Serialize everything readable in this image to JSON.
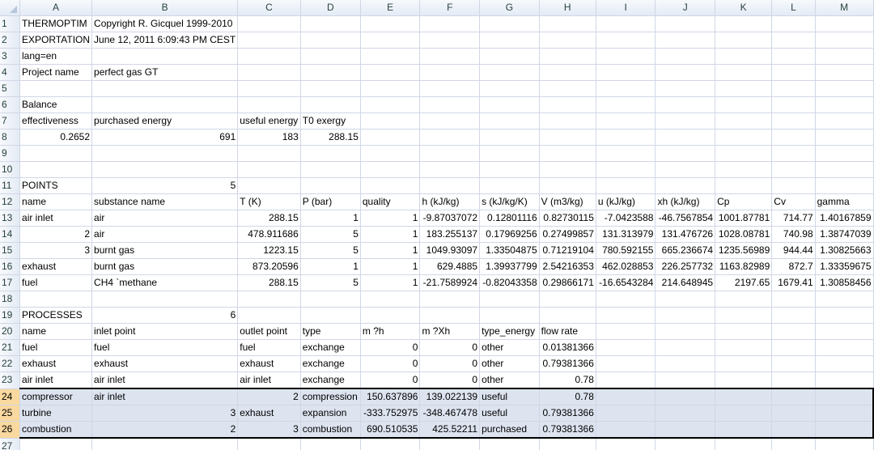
{
  "columns": [
    "A",
    "B",
    "C",
    "D",
    "E",
    "F",
    "G",
    "H",
    "I",
    "J",
    "K",
    "L",
    "M"
  ],
  "rows": [
    {
      "n": "1",
      "cells": [
        "THERMOPTIM",
        "Copyright R. Gicquel 1999-2010",
        "",
        "",
        "",
        "",
        "",
        "",
        "",
        "",
        "",
        "",
        ""
      ]
    },
    {
      "n": "2",
      "cells": [
        "EXPORTATION",
        "June 12, 2011 6:09:43 PM CEST",
        "",
        "",
        "",
        "",
        "",
        "",
        "",
        "",
        "",
        "",
        ""
      ]
    },
    {
      "n": "3",
      "cells": [
        "lang=en",
        "",
        "",
        "",
        "",
        "",
        "",
        "",
        "",
        "",
        "",
        "",
        ""
      ]
    },
    {
      "n": "4",
      "cells": [
        "Project name",
        "perfect gas GT",
        "",
        "",
        "",
        "",
        "",
        "",
        "",
        "",
        "",
        "",
        ""
      ]
    },
    {
      "n": "5",
      "cells": [
        "",
        "",
        "",
        "",
        "",
        "",
        "",
        "",
        "",
        "",
        "",
        "",
        ""
      ]
    },
    {
      "n": "6",
      "cells": [
        "Balance",
        "",
        "",
        "",
        "",
        "",
        "",
        "",
        "",
        "",
        "",
        "",
        ""
      ]
    },
    {
      "n": "7",
      "cells": [
        "effectiveness",
        "purchased energy",
        "useful energy",
        "T0 exergy",
        "",
        "",
        "",
        "",
        "",
        "",
        "",
        "",
        ""
      ]
    },
    {
      "n": "8",
      "cells": [
        "0.2652",
        "691",
        "183",
        "288.15",
        "",
        "",
        "",
        "",
        "",
        "",
        "",
        "",
        ""
      ]
    },
    {
      "n": "9",
      "cells": [
        "",
        "",
        "",
        "",
        "",
        "",
        "",
        "",
        "",
        "",
        "",
        "",
        ""
      ]
    },
    {
      "n": "10",
      "cells": [
        "",
        "",
        "",
        "",
        "",
        "",
        "",
        "",
        "",
        "",
        "",
        "",
        ""
      ]
    },
    {
      "n": "11",
      "cells": [
        "POINTS",
        "5",
        "",
        "",
        "",
        "",
        "",
        "",
        "",
        "",
        "",
        "",
        ""
      ]
    },
    {
      "n": "12",
      "cells": [
        "name",
        "substance name",
        "T (K)",
        "P (bar)",
        "quality",
        "h (kJ/kg)",
        "s (kJ/kg/K)",
        "V (m3/kg)",
        "u (kJ/kg)",
        "xh (kJ/kg)",
        "Cp",
        "Cv",
        "gamma"
      ]
    },
    {
      "n": "13",
      "cells": [
        "air inlet",
        "air",
        "288.15",
        "1",
        "1",
        "-9.87037072",
        "0.12801116",
        "0.82730115",
        "-7.0423588",
        "-46.7567854",
        "1001.87781",
        "714.77",
        "1.40167859"
      ]
    },
    {
      "n": "14",
      "cells": [
        "2",
        "air",
        "478.911686",
        "5",
        "1",
        "183.255137",
        "0.17969256",
        "0.27499857",
        "131.313979",
        "131.476726",
        "1028.08781",
        "740.98",
        "1.38747039"
      ]
    },
    {
      "n": "15",
      "cells": [
        "3",
        "burnt gas",
        "1223.15",
        "5",
        "1",
        "1049.93097",
        "1.33504875",
        "0.71219104",
        "780.592155",
        "665.236674",
        "1235.56989",
        "944.44",
        "1.30825663"
      ]
    },
    {
      "n": "16",
      "cells": [
        "exhaust",
        "burnt gas",
        "873.20596",
        "1",
        "1",
        "629.4885",
        "1.39937799",
        "2.54216353",
        "462.028853",
        "226.257732",
        "1163.82989",
        "872.7",
        "1.33359675"
      ]
    },
    {
      "n": "17",
      "cells": [
        "fuel",
        "CH4 `methane",
        "288.15",
        "5",
        "1",
        "-21.7589924",
        "-0.82043358",
        "0.29866171",
        "-16.6543284",
        "214.648945",
        "2197.65",
        "1679.41",
        "1.30858456"
      ]
    },
    {
      "n": "18",
      "cells": [
        "",
        "",
        "",
        "",
        "",
        "",
        "",
        "",
        "",
        "",
        "",
        "",
        ""
      ]
    },
    {
      "n": "19",
      "cells": [
        "PROCESSES",
        "6",
        "",
        "",
        "",
        "",
        "",
        "",
        "",
        "",
        "",
        "",
        ""
      ]
    },
    {
      "n": "20",
      "cells": [
        "name",
        "inlet point",
        "outlet point",
        "type",
        "m ?h",
        "m ?Xh",
        "type_energy",
        "flow rate",
        "",
        "",
        "",
        "",
        ""
      ]
    },
    {
      "n": "21",
      "cells": [
        "fuel",
        "fuel",
        "fuel",
        "exchange",
        "0",
        "0",
        "other",
        "0.01381366",
        "",
        "",
        "",
        "",
        ""
      ]
    },
    {
      "n": "22",
      "cells": [
        "exhaust",
        "exhaust",
        "exhaust",
        "exchange",
        "0",
        "0",
        "other",
        "0.79381366",
        "",
        "",
        "",
        "",
        ""
      ]
    },
    {
      "n": "23",
      "cells": [
        "air inlet",
        "air inlet",
        "air inlet",
        "exchange",
        "0",
        "0",
        "other",
        "0.78",
        "",
        "",
        "",
        "",
        ""
      ]
    },
    {
      "n": "24",
      "cells": [
        "compressor",
        "air inlet",
        "2",
        "compression",
        "150.637896",
        "139.022139",
        "useful",
        "0.78",
        "",
        "",
        "",
        "",
        ""
      ]
    },
    {
      "n": "25",
      "cells": [
        "turbine",
        "3",
        "exhaust",
        "expansion",
        "-333.752975",
        "-348.467478",
        "useful",
        "0.79381366",
        "",
        "",
        "",
        "",
        ""
      ]
    },
    {
      "n": "26",
      "cells": [
        "combustion",
        "2",
        "3",
        "combustion",
        "690.510535",
        "425.52211",
        "purchased",
        "0.79381366",
        "",
        "",
        "",
        "",
        ""
      ]
    },
    {
      "n": "27",
      "cells": [
        "",
        "",
        "",
        "",
        "",
        "",
        "",
        "",
        "",
        "",
        "",
        "",
        ""
      ]
    }
  ],
  "selected_rows": [
    "24",
    "25",
    "26"
  ]
}
